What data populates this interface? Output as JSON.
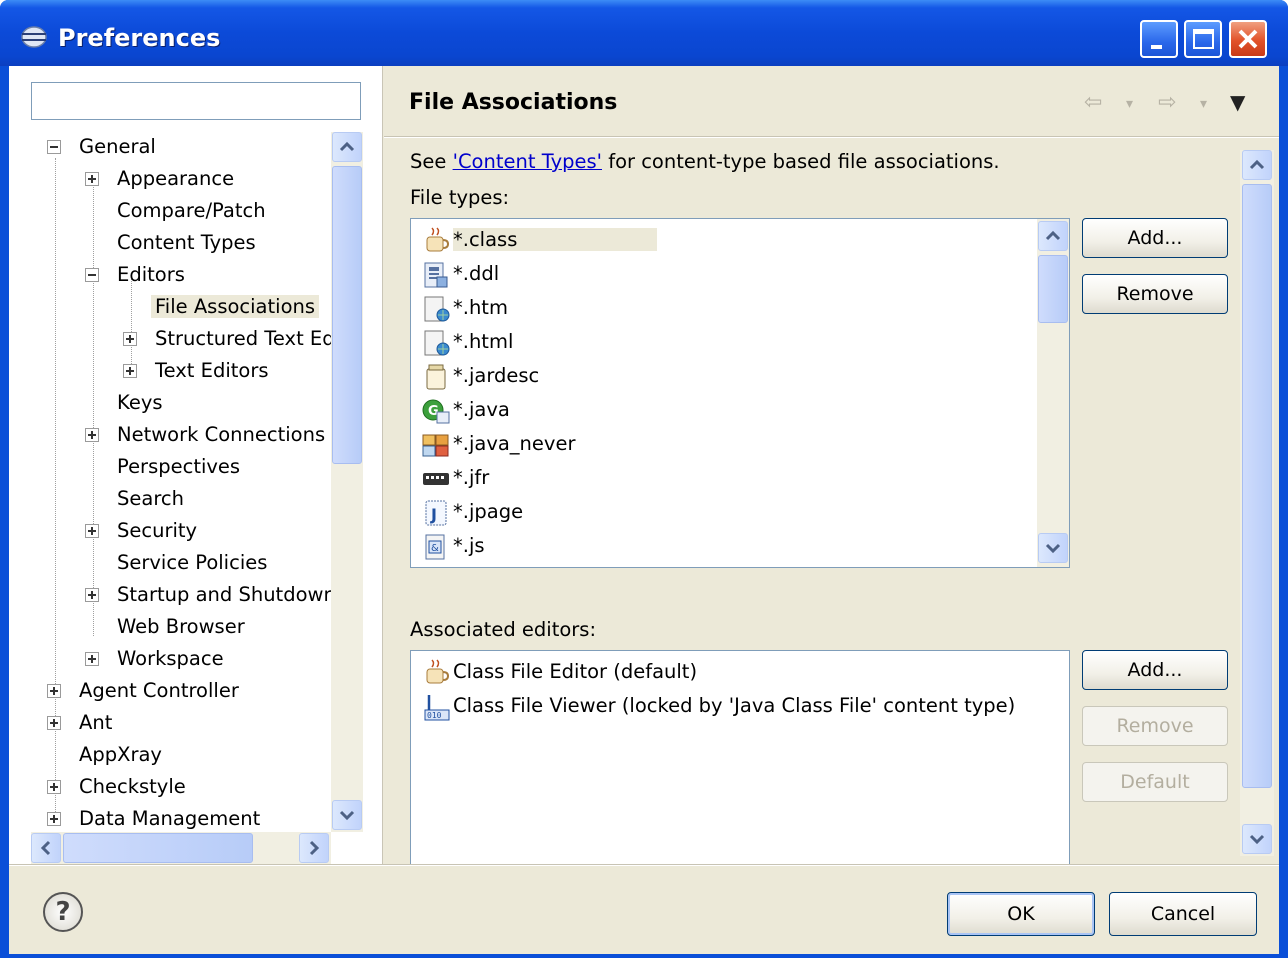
{
  "window": {
    "title": "Preferences"
  },
  "filter": {
    "value": "",
    "placeholder": ""
  },
  "tree": [
    {
      "label": "General",
      "expanded": true
    },
    {
      "label": "Appearance",
      "expandable": true
    },
    {
      "label": "Compare/Patch"
    },
    {
      "label": "Content Types"
    },
    {
      "label": "Editors",
      "expanded": true
    },
    {
      "label": "File Associations",
      "selected": true
    },
    {
      "label": "Structured Text Ed",
      "expandable": true
    },
    {
      "label": "Text Editors",
      "expandable": true
    },
    {
      "label": "Keys"
    },
    {
      "label": "Network Connections",
      "expandable": true
    },
    {
      "label": "Perspectives"
    },
    {
      "label": "Search"
    },
    {
      "label": "Security",
      "expandable": true
    },
    {
      "label": "Service Policies"
    },
    {
      "label": "Startup and Shutdowr",
      "expandable": true
    },
    {
      "label": "Web Browser"
    },
    {
      "label": "Workspace",
      "expandable": true
    },
    {
      "label": "Agent Controller",
      "expandable": true
    },
    {
      "label": "Ant",
      "expandable": true
    },
    {
      "label": "AppXray"
    },
    {
      "label": "Checkstyle",
      "expandable": true
    },
    {
      "label": "Data Management",
      "expandable": true
    }
  ],
  "page": {
    "title": "File Associations",
    "desc_prefix": "See ",
    "desc_link": "'Content Types'",
    "desc_suffix": " for content-type based file associations.",
    "file_types_label": "File types:",
    "associated_editors_label": "Associated editors:"
  },
  "file_types": [
    {
      "label": "*.class",
      "icon": "coffee-cup-icon",
      "selected": true
    },
    {
      "label": "*.ddl",
      "icon": "database-file-icon"
    },
    {
      "label": "*.htm",
      "icon": "web-page-icon"
    },
    {
      "label": "*.html",
      "icon": "web-page-icon"
    },
    {
      "label": "*.jardesc",
      "icon": "jar-descriptor-icon"
    },
    {
      "label": "*.java",
      "icon": "java-file-icon"
    },
    {
      "label": "*.java_never",
      "icon": "java-never-icon"
    },
    {
      "label": "*.jfr",
      "icon": "flight-recorder-icon"
    },
    {
      "label": "*.jpage",
      "icon": "scrapbook-page-icon"
    },
    {
      "label": "*.js",
      "icon": "javascript-file-icon"
    }
  ],
  "editors": [
    {
      "label": "Class File Editor (default)",
      "icon": "coffee-cup-icon"
    },
    {
      "label": "Class File Viewer (locked by 'Java Class File' content type)",
      "icon": "binary-file-icon"
    }
  ],
  "buttons": {
    "types_add": "Add...",
    "types_remove": "Remove",
    "editors_add": "Add...",
    "editors_remove": "Remove",
    "editors_default": "Default",
    "ok": "OK",
    "cancel": "Cancel"
  },
  "colors": {
    "title_bar": "#0a4fd8",
    "dialog_bg": "#ece9d8",
    "link": "#0000cc",
    "selection": "#ece9d8"
  }
}
